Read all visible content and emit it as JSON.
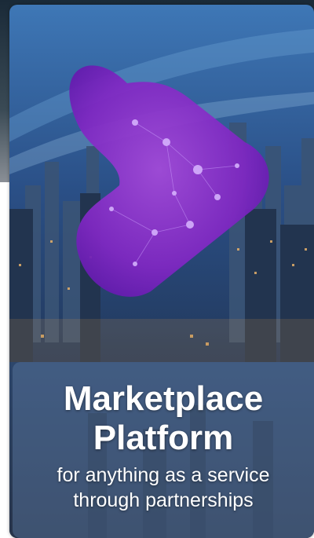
{
  "banner": {
    "title_line1": "Marketplace",
    "title_line2": "Platform",
    "subtitle_line1": "for anything as a service",
    "subtitle_line2": "through partnerships"
  },
  "colors": {
    "brand_purple": "#8a2fc6",
    "brand_violet": "#5a1aa8",
    "sky_top": "#1f3d6b",
    "sky_mid": "#3f6c9a",
    "city_glow": "#e0a85a"
  },
  "icons": {
    "logo": "heart-arrow-logo"
  }
}
